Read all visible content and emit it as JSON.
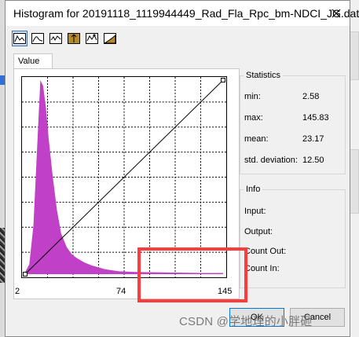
{
  "window": {
    "title": "Histogram for 20191118_1119944449_Rad_Fla_Rpc_bm-NDCI_JG.dat"
  },
  "toolbar": {
    "buttons": [
      "histogram-linear-icon",
      "histogram-gaussian-icon",
      "histogram-equalize-icon",
      "histogram-threshold-icon",
      "histogram-custom-icon",
      "histogram-cumulative-icon"
    ]
  },
  "tab": {
    "label": "Value"
  },
  "axis": {
    "x_ticks": [
      "2",
      "74",
      "145"
    ]
  },
  "statistics": {
    "title": "Statistics",
    "rows": [
      {
        "label": "min:",
        "value": "2.58"
      },
      {
        "label": "max:",
        "value": "145.83"
      },
      {
        "label": "mean:",
        "value": "23.17"
      },
      {
        "label": "std. deviation:",
        "value": "12.50"
      }
    ]
  },
  "info": {
    "title": "Info",
    "rows": [
      "Input:",
      "Output:",
      "Count Out:",
      "Count In:"
    ]
  },
  "buttons": {
    "ok": "OK",
    "cancel": "Cancel"
  },
  "watermark": "CSDN @学地理的小胖砸",
  "chart_data": {
    "type": "area",
    "x": [
      2,
      5,
      8,
      10,
      12,
      13,
      15,
      17,
      19,
      22,
      25,
      28,
      32,
      36,
      40,
      45,
      50,
      55,
      60,
      65,
      70,
      80,
      90,
      100,
      110,
      120,
      130,
      140,
      145
    ],
    "values": [
      0.01,
      0.05,
      0.25,
      0.55,
      0.85,
      1.0,
      0.97,
      0.86,
      0.7,
      0.5,
      0.33,
      0.21,
      0.14,
      0.1,
      0.08,
      0.06,
      0.045,
      0.035,
      0.025,
      0.02,
      0.015,
      0.012,
      0.01,
      0.009,
      0.008,
      0.007,
      0.006,
      0.006,
      0.006
    ],
    "xlim": [
      2,
      145
    ],
    "ylim": [
      0,
      1
    ],
    "x_ticks": [
      "2",
      "74",
      "145"
    ],
    "color": "#c040c8",
    "grid": true,
    "transfer_line": {
      "from": [
        2,
        0
      ],
      "to": [
        145,
        1
      ]
    }
  },
  "colors": {
    "histogram": "#c040c8",
    "highlight": "#ff3b3b",
    "ok_border": "#0078d7"
  }
}
